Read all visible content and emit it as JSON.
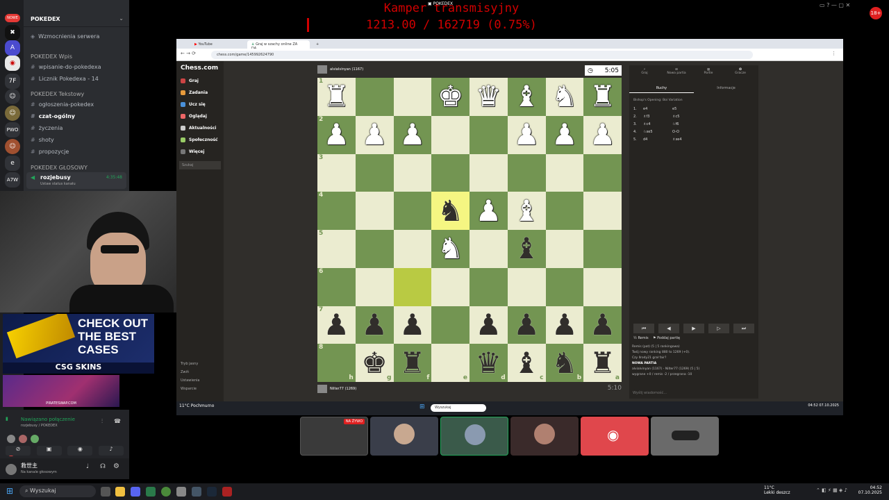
{
  "overlay": {
    "title": "Kamper transmisyjny",
    "count": "1213.00 / 162719 (0.75%)",
    "window_title": "POKEDEX"
  },
  "discord": {
    "server": "POKEDEX",
    "new_badge": "NOWE",
    "boost": "Wzmocnienia serwera",
    "cat1": "POKEDEX Wpis",
    "ch_wpisanie": "wpisanie-do-pokedexa",
    "ch_licznik": "Licznik Pokedexa - 14",
    "cat2": "POKEDEX Tekstowy",
    "ch_ogloszenia": "ogłoszenia-pokedex",
    "ch_czat": "czat-ogólny",
    "ch_zyczenia": "życzenia",
    "ch_shoty": "shoty",
    "ch_propozycje": "propozycje",
    "cat3": "POKEDEX GŁOSOWY",
    "voice_ch": "rozjebusy",
    "voice_time": "4:35:48",
    "voice_status": "Ustaw status kanału",
    "connected": "Nawiązano połączenie",
    "connected_sub": "rozjebusy / POKEDEX",
    "user": "救世主",
    "user_status": "Na kanale głosowym",
    "servers": [
      "A",
      "7F",
      "PWO",
      "e",
      "A7W"
    ],
    "ad1": "CHECK OUT THE BEST CASES",
    "ad1_brand": "CSG SKINS",
    "ad2_brand": "PIRATESWAP.COM"
  },
  "browser": {
    "tab1": "YouTube",
    "tab2": "Graj w szachy online ZA DA...",
    "url": "chess.com/game/145992624790"
  },
  "chesscom": {
    "logo": "Chess.com",
    "nav": [
      "Graj",
      "Zadania",
      "Ucz się",
      "Oglądaj",
      "Aktualności",
      "Społeczność",
      "Więcej"
    ],
    "search": "Szukaj",
    "footer": [
      "Tryb jasny",
      "Zwiń",
      "Ustawienia",
      "Wsparcie"
    ],
    "top_player": "alvialvinyan (1167)",
    "bottom_player": "Nilter77 (1269)",
    "clock_top": "5:05",
    "clock_bottom": "5:10",
    "tabs": [
      "Graj",
      "Nowa partia",
      "Partie",
      "Gracze"
    ],
    "subtabs": [
      "Ruchy",
      "Informacje"
    ],
    "opening": "Bishop's Opening: Boi Variation",
    "moves": [
      {
        "n": "1.",
        "w": "e4",
        "b": "e5"
      },
      {
        "n": "2.",
        "w": "♗f3",
        "b": "♗c5"
      },
      {
        "n": "3.",
        "w": "♗c4",
        "b": "♘f6"
      },
      {
        "n": "4.",
        "w": "♘xe5",
        "b": "O-O"
      },
      {
        "n": "5.",
        "w": "d4",
        "b": "♗xe4"
      }
    ],
    "draw": "Remis",
    "resign": "Poddaj partię",
    "chat": [
      "Remis (pat) (5 | 5 rankingowa)",
      "Twój nowy ranking 880 to 1269 (+0).",
      "Czy Ilrody21 grał fair?",
      "NOWA PARTIA",
      "alvialvinyan (1167) - Nilter77 (1269) (5 | 5)",
      "wygrane +0 / remis -2 / przegrana -10"
    ],
    "chat_input": "Wyślij wiadomość..."
  },
  "board": {
    "ranks": [
      "1",
      "2",
      "3",
      "4",
      "5",
      "6",
      "7",
      "8"
    ],
    "files": [
      "h",
      "g",
      "f",
      "e",
      "d",
      "c",
      "b",
      "a"
    ],
    "rows": [
      [
        "wR",
        "",
        "",
        "wK",
        "wQ",
        "wB",
        "wN",
        "wR"
      ],
      [
        "wP",
        "wP",
        "wP",
        "",
        "",
        "wP",
        "wP",
        "wP"
      ],
      [
        "",
        "",
        "",
        "",
        "",
        "",
        "",
        ""
      ],
      [
        "",
        "",
        "",
        "bN",
        "wP",
        "wB",
        "",
        ""
      ],
      [
        "",
        "",
        "",
        "wN",
        "",
        "bB",
        "",
        ""
      ],
      [
        "",
        "",
        "",
        "",
        "",
        "",
        "",
        ""
      ],
      [
        "bP",
        "bP",
        "bP",
        "",
        "bP",
        "bP",
        "bP",
        "bP"
      ],
      [
        "",
        "bK",
        "bR",
        "",
        "bQ",
        "bB",
        "bN",
        "bR"
      ]
    ],
    "highlights": [
      "3-3",
      "5-2"
    ]
  },
  "windows": {
    "search": "Wyszukaj",
    "weather": "11°C",
    "weather_sub": "Pochmurno",
    "weather2": "11°C",
    "weather2_sub": "Lekki deszcz",
    "time": "04:52",
    "date": "07.10.2025",
    "live": "NA ŻYWO"
  }
}
